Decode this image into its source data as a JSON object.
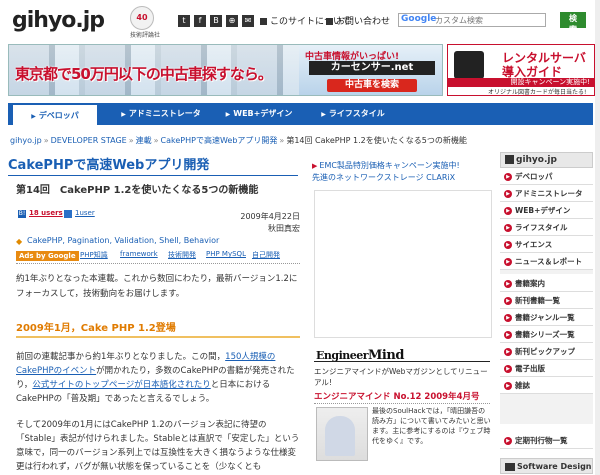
{
  "header": {
    "logo": "gihyo.jp",
    "logo_badge": "40",
    "logo_sub": "技術評論社",
    "social_icons": [
      "twitter-icon",
      "facebook-icon",
      "hatena-icon",
      "rss-icon",
      "mail-icon"
    ],
    "links": [
      "このサイトについて",
      "お問い合わせ"
    ],
    "search_placeholder": "カスタム検索",
    "google_mark": "Google",
    "search_button": "検索"
  },
  "banner_main": {
    "headline": "東京都で50万円以下の中古車探すなら。",
    "top_text": "中古車情報がいっぱい!",
    "brand": "カーセンサー.net",
    "cta": "中古車を検索"
  },
  "banner_side": {
    "line1": "レンタルサーバ",
    "line2": "導入ガイド",
    "line3": "開設キャンペーン実施中!",
    "line4": "オリジナル図書カードが毎日当たる!"
  },
  "nav": {
    "tabs": [
      "デベロッパ",
      "アドミニストレータ",
      "WEB+デザイン",
      "ライフスタイル"
    ],
    "active": 0
  },
  "breadcrumb": [
    "gihyo.jp",
    "DEVELOPER STAGE",
    "連載",
    "CakePHPで高速Webアプリ開発",
    "第14回 CakePHP 1.2を使いたくなる5つの新機能"
  ],
  "article": {
    "series_title": "CakePHPで高速Webアプリ開発",
    "title": "第14回　CakePHP 1.2を使いたくなる5つの新機能",
    "bookmark_icon": "B!",
    "bookmark_count": "18 users",
    "user_count": "1user",
    "date": "2009年4月22日",
    "author": "秋田真宏",
    "tags": "CakePHP, Pagination, Validation, Shell, Behavior",
    "ads_label": "Ads by Google",
    "ad_links": [
      "PHP知識",
      "framework",
      "技術開発",
      "PHP MySQL",
      "自己開発"
    ],
    "intro": "約1年ぶりとなった本連載。これから数回にわたり，最新バージョン1.2にフォーカスして，技術動向をお届けします。",
    "section_heading": "2009年1月，Cake PHP 1.2登場",
    "para1_a": "前回の連載記事から約1年ぶりとなりました。この間，",
    "para1_link1": "150人規模のCakePHPのイベント",
    "para1_b": "が開かれたり，多数のCakePHPの書籍が発売されたり，",
    "para1_link2": "公式サイトのトップページが日本語化されたり",
    "para1_c": "と日本における CakePHPの「普及期」であったと言えるでしょう。",
    "para2": "そして2009年の1月にはCakePHP 1.2のバージョン表記に待望の「Stable」表記が付けられました。Stableとは直訳で「安定した」という意味で，同一のバージョン系列上では互換性を大きく損なうような仕様変更は行われず，バグが無い状態を保っていることを（少なくとも"
  },
  "center": {
    "news": [
      "EMC製品特別価格キャンペーン実施中!",
      "先進のネットワークストレージ CLARiX"
    ],
    "em_logo_a": "Engineer",
    "em_logo_b": "Mind",
    "em_desc": "エンジニアマインドがWebマガジンとしてリニューアル!",
    "em_issue": "エンジニアマインド No.12 2009年4月号",
    "em_text": "最後のSoulHackでは，「晴田謙吾の読み方」について書いてみたいと思います。主に参考にするのは『ウェブ時代をゆく』です。"
  },
  "sidebar": {
    "head": "gihyo.jp",
    "items_a": [
      "デベロッパ",
      "アドミニストレータ",
      "WEB+デザイン",
      "ライフスタイル",
      "サイエンス",
      "ニュース＆レポート"
    ],
    "items_b": [
      "書籍案内",
      "新刊書籍一覧",
      "書籍ジャンル一覧",
      "書籍シリーズ一覧",
      "新刊ピックアップ",
      "電子出版",
      "雑誌"
    ],
    "items_c": [
      "定期刊行物一覧"
    ],
    "bottom": "Software Design"
  },
  "colors": {
    "brand_blue": "#1a5fb4",
    "accent_red": "#c8102e",
    "accent_orange": "#e07b00"
  }
}
